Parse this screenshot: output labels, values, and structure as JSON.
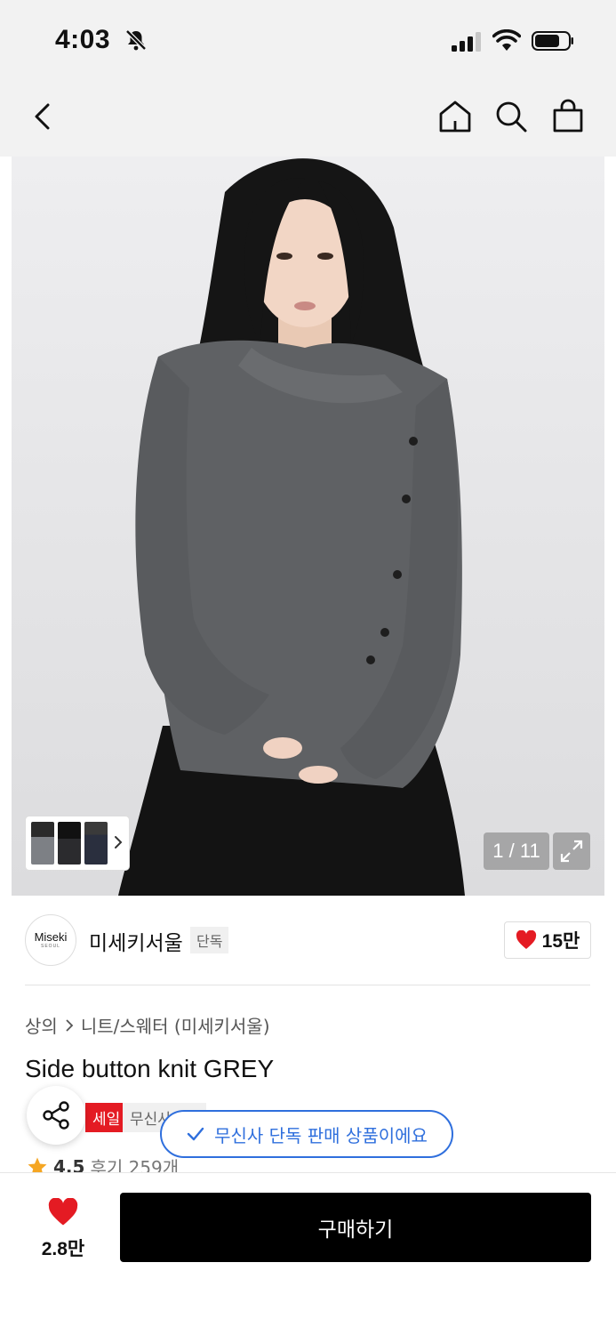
{
  "status_bar": {
    "time": "4:03"
  },
  "product_image": {
    "counter": "1 / 11"
  },
  "brand": {
    "logo_text": "Miseki",
    "logo_subtext": "SEOUL",
    "name": "미세키서울",
    "tag": "단독",
    "likes": "15만"
  },
  "details": {
    "breadcrumb": [
      "상의",
      "니트/스웨터 (미세키서울)"
    ],
    "title": "Side button knit GREY",
    "badges": [
      "세일",
      "무신사단독"
    ],
    "rating": "4.5",
    "reviews": "후기 259개"
  },
  "toast": "무신사 단독 판매 상품이에요",
  "bottom_bar": {
    "likes": "2.8만",
    "buy_label": "구매하기"
  },
  "colors": {
    "accent_red": "#e41b23",
    "toast_blue": "#2f6fdd",
    "buy_bg": "#000000",
    "star": "#f5a623"
  }
}
